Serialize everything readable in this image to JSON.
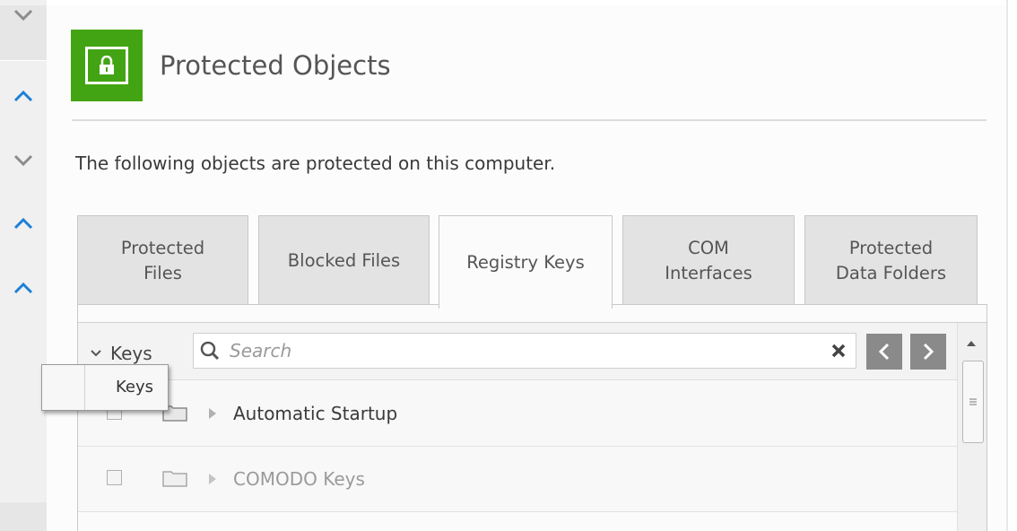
{
  "header": {
    "title": "Protected Objects",
    "description": "The following objects are protected on this computer."
  },
  "tabs": [
    {
      "lines": [
        "Protected",
        "Files"
      ],
      "selected": false
    },
    {
      "lines": [
        "Blocked Files"
      ],
      "selected": false
    },
    {
      "lines": [
        "Registry Keys"
      ],
      "selected": true
    },
    {
      "lines": [
        "COM",
        "Interfaces"
      ],
      "selected": false
    },
    {
      "lines": [
        "Protected",
        "Data Folders"
      ],
      "selected": false
    }
  ],
  "toolbar": {
    "filter_label": "Keys",
    "search_placeholder": "Search"
  },
  "dropdown": {
    "options": [
      "Keys"
    ]
  },
  "rows": [
    {
      "label": "Automatic Startup"
    },
    {
      "label": "COMODO Keys"
    }
  ],
  "colors": {
    "accent_green": "#43a413",
    "chevron_blue": "#1e7fd8",
    "chevron_gray": "#8c8c8c"
  },
  "icons": {
    "header": "lock-icon",
    "search": "search-icon",
    "clear": "close-icon",
    "prev": "chevron-left-icon",
    "next": "chevron-right-icon"
  }
}
